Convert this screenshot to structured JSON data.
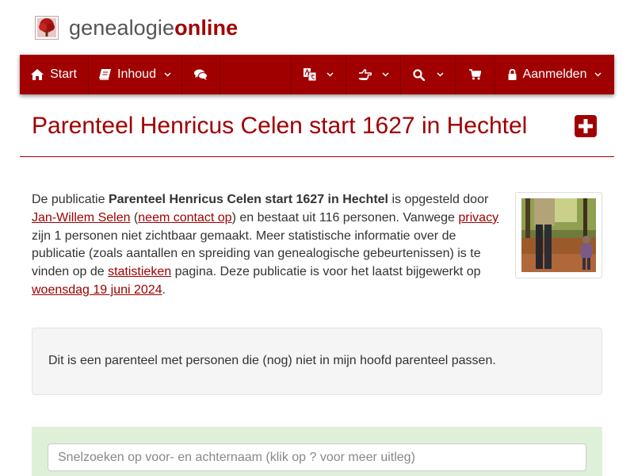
{
  "brand": {
    "text_plain": "genealogie",
    "text_bold": "online",
    "logo_icon": "tree-icon",
    "accent_color": "#a00000"
  },
  "navbar": {
    "start_label": "Start",
    "inhoud_label": "Inhoud",
    "login_label": "Aanmelden",
    "icons": [
      "home-icon",
      "book-icon",
      "comments-icon",
      "language-icon",
      "hand-pointer-icon",
      "search-icon",
      "cart-icon",
      "lock-icon"
    ]
  },
  "page": {
    "title": "Parenteel Henricus Celen start 1627 in Hechtel"
  },
  "intro": {
    "t1": "De publicatie ",
    "pub_name": "Parenteel Henricus Celen start 1627 in Hechtel",
    "t2": " is opgesteld door ",
    "author_link": "Jan-Willem Selen",
    "t3": " (",
    "contact_link": "neem contact op",
    "t4": ") en bestaat uit 116 personen. Vanwege ",
    "privacy_link": "privacy",
    "t5": " zijn 1 personen niet zichtbaar gemaakt. Meer statistische informatie over de publicatie (zoals aantallen en spreiding van genealogische gebeurtenissen) is te vinden op de ",
    "stats_link": "statistieken",
    "t6": " pagina. Deze publicatie is voor het laatst bijgewerkt op ",
    "date_link": "woensdag 19 juni 2024",
    "t7": "."
  },
  "note": {
    "text": "Dit is een parenteel met personen die (nog) niet in mijn hoofd parenteel passen."
  },
  "search": {
    "placeholder": "Snelzoeken op voor- en achternaam (klik op ? voor meer uitleg)"
  }
}
